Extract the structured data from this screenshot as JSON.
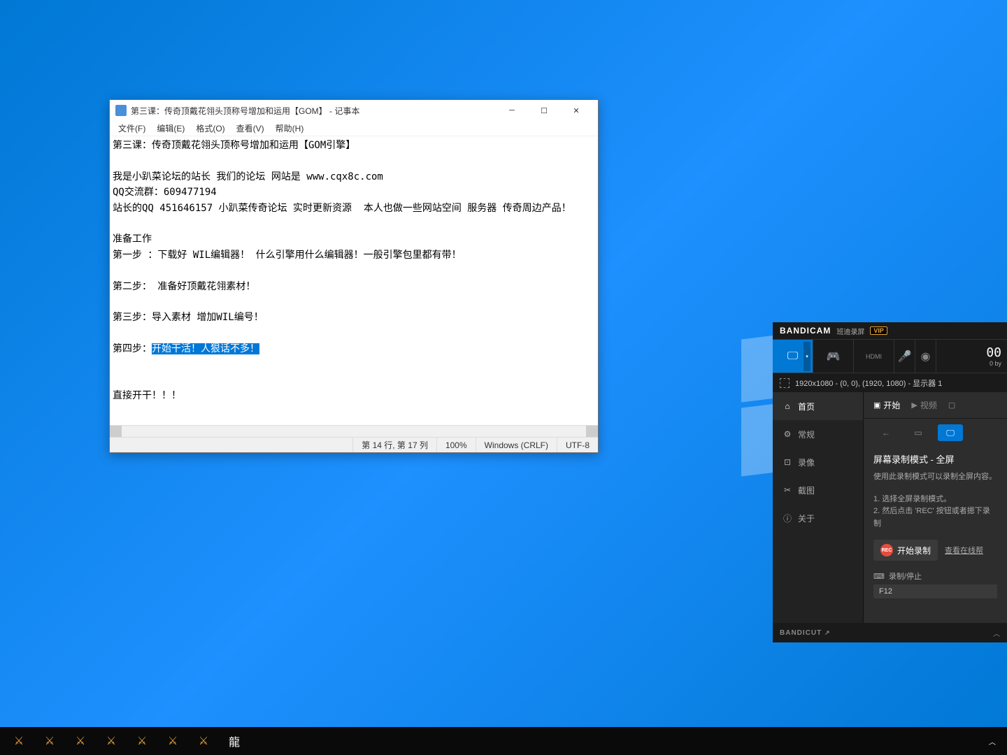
{
  "notepad": {
    "title": "第三课：传奇顶戴花翎头顶称号增加和运用【GOM】 - 记事本",
    "menu": [
      "文件(F)",
      "编辑(E)",
      "格式(O)",
      "查看(V)",
      "帮助(H)"
    ],
    "content_lines": [
      "第三课：传奇顶戴花翎头顶称号增加和运用【GOM引擎】",
      "",
      "我是小趴菜论坛的站长 我们的论坛 网站是 www.cqx8c.com",
      "QQ交流群：609477194",
      "站长的QQ 451646157 小趴菜传奇论坛 实时更新资源  本人也做一些网站空间 服务器 传奇周边产品！",
      "",
      "准备工作",
      "第一步 ：下载好 WIL编辑器！ 什么引擎用什么编辑器！一般引擎包里都有带！",
      "",
      "第二步： 准备好顶戴花翎素材！",
      "",
      "第三步：导入素材 增加WIL编号！",
      "",
      "第四步："
    ],
    "highlighted": "开始干活！人狠话不多！",
    "content_after": [
      "",
      "",
      "直接开干！！！"
    ],
    "status": {
      "position": "第 14 行, 第 17 列",
      "zoom": "100%",
      "eol": "Windows (CRLF)",
      "encoding": "UTF-8"
    }
  },
  "bandicam": {
    "logo": "BANDICAM",
    "sub": "班迪录屏",
    "vip": "VIP",
    "counter_time": "00",
    "counter_bytes": "0 by",
    "info": "1920x1080 - (0, 0), (1920, 1080) - 显示器 1",
    "sidebar": [
      {
        "icon": "⌂",
        "label": "首页",
        "active": true
      },
      {
        "icon": "⚙",
        "label": "常规"
      },
      {
        "icon": "⊡",
        "label": "录像"
      },
      {
        "icon": "✂",
        "label": "截图"
      },
      {
        "icon": "ⓘ",
        "label": "关于"
      }
    ],
    "tabs": [
      {
        "icon": "▣",
        "label": "开始",
        "active": true
      },
      {
        "icon": "▶",
        "label": "视频"
      },
      {
        "icon": "▢",
        "label": ""
      }
    ],
    "section_title": "屏幕录制模式 - 全屏",
    "section_desc": "使用此录制模式可以录制全屏内容。",
    "steps": [
      "1. 选择全屏录制模式。",
      "2. 然后点击 'REC' 按钮或者摁下录制"
    ],
    "rec_label": "开始录制",
    "help_link": "查看在线帮",
    "field_label": "录制/停止",
    "field_value": "F12",
    "bandicut": "BANDICUT"
  }
}
